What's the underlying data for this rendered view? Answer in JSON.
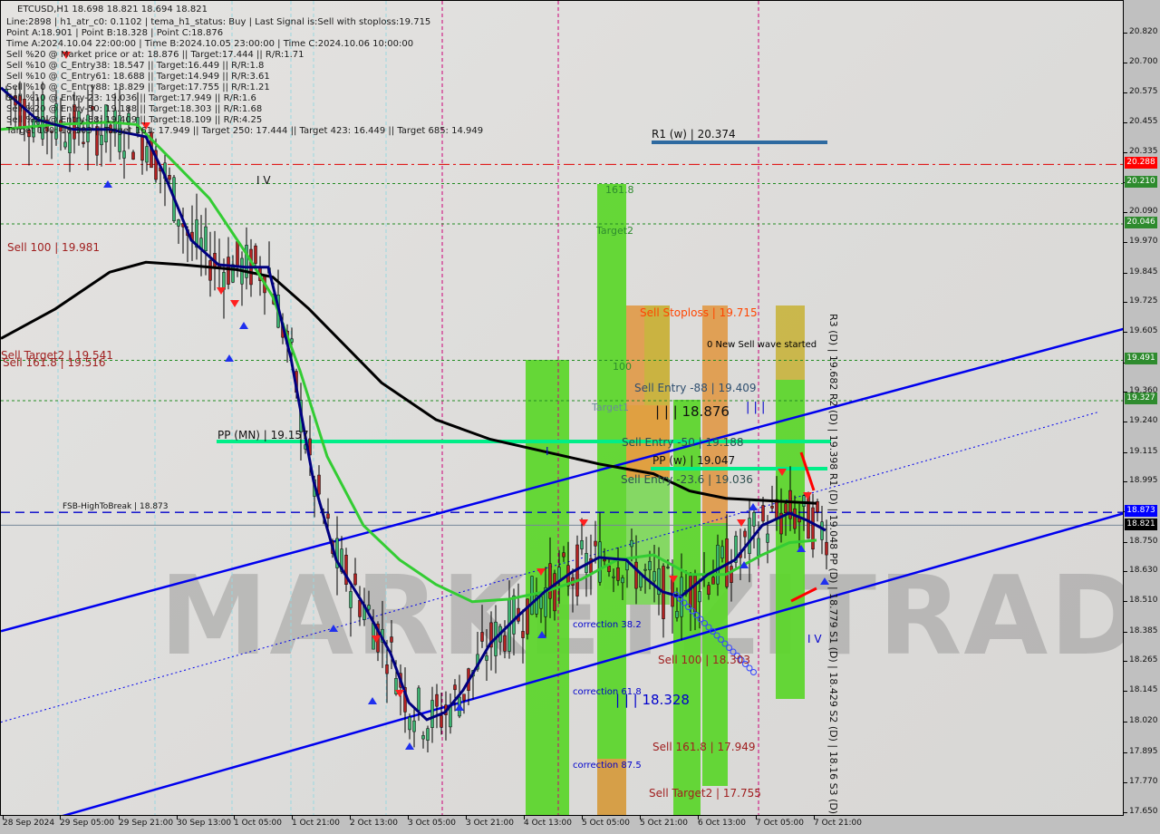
{
  "header": {
    "symbol_line": "ETCUSD,H1  18.698 18.821 18.694 18.821",
    "info_lines": [
      "Line:2898 | h1_atr_c0: 0.1102 | tema_h1_status: Buy | Last Signal is:Sell with stoploss:19.715",
      "Point A:18.901 | Point B:18.328 | Point C:18.876",
      "Time A:2024.10.04 22:00:00 | Time B:2024.10.05 23:00:00 | Time C:2024.10.06 10:00:00",
      "Sell %20 @ Market price or at: 18.876 || Target:17.444 || R/R:1.71",
      "Sell %10 @ C_Entry38: 18.547 || Target:16.449 || R/R:1.8",
      "Sell %10 @ C_Entry61: 18.688 || Target:14.949 || R/R:3.61",
      "Sell %10 @ C_Entry88: 18.829 || Target:17.755 || R/R:1.21",
      "Sell %10 @ Entry-23: 19.036 || Target:17.949 || R/R:1.6",
      "Sell %20 @ Entry-50: 19.188 || Target:18.303 || R/R:1.68",
      "Sell %20 @ Entry-88: 19.409 || Target:18.109 || R/R:4.25",
      "Target 100: 18.303 || Target 161: 17.949 || Target 250: 17.444 || Target 423: 16.449 || Target 685: 14.949"
    ]
  },
  "watermark": "MARKETZITRADE",
  "chart_data": {
    "type": "candlestick",
    "title": "ETCUSD,H1",
    "ohlc_last": {
      "open": 18.698,
      "high": 18.821,
      "low": 18.694,
      "close": 18.821
    },
    "ylim": [
      17.65,
      20.88
    ],
    "y_ticks": [
      20.82,
      20.7,
      20.575,
      20.455,
      20.335,
      20.21,
      20.09,
      19.97,
      19.845,
      19.725,
      19.605,
      19.48,
      19.36,
      19.24,
      19.115,
      18.995,
      18.873,
      18.75,
      18.63,
      18.51,
      18.385,
      18.265,
      18.145,
      18.02,
      17.895,
      17.77,
      17.65
    ],
    "y_tick_labels": [
      "20.820",
      "20.700",
      "20.575",
      "20.455",
      "20.335",
      "20.210",
      "20.090",
      "19.970",
      "19.845",
      "19.725",
      "19.605",
      "19.480",
      "19.360",
      "19.240",
      "19.115",
      "18.995",
      "18.873",
      "18.750",
      "18.630",
      "18.510",
      "18.385",
      "18.265",
      "18.145",
      "18.020",
      "17.895",
      "17.770",
      "17.650"
    ],
    "x_tick_labels": [
      "28 Sep 2024",
      "29 Sep 05:00",
      "29 Sep 21:00",
      "30 Sep 13:00",
      "1 Oct 05:00",
      "1 Oct 21:00",
      "2 Oct 13:00",
      "3 Oct 05:00",
      "3 Oct 21:00",
      "4 Oct 13:00",
      "5 Oct 05:00",
      "5 Oct 21:00",
      "6 Oct 13:00",
      "7 Oct 05:00",
      "7 Oct 21:00"
    ],
    "price_badges": [
      {
        "value": "20.288",
        "color": "#ff0000"
      },
      {
        "value": "20.210",
        "color": "#2e8b2e"
      },
      {
        "value": "20.046",
        "color": "#2e8b2e"
      },
      {
        "value": "19.491",
        "color": "#2e8b2e"
      },
      {
        "value": "19.327",
        "color": "#2e8b2e"
      },
      {
        "value": "18.873",
        "color": "#0000ff"
      },
      {
        "value": "18.821",
        "color": "#000000"
      }
    ],
    "horizontal_levels": [
      {
        "name": "stoploss-level",
        "value": 20.288,
        "color": "#e00000",
        "style": "dashdot"
      },
      {
        "name": "target-161-level",
        "value": 20.21,
        "color": "#228b22",
        "style": "dotted"
      },
      {
        "name": "target2-level",
        "value": 20.046,
        "color": "#228b22",
        "style": "dotted"
      },
      {
        "name": "target-100-level",
        "value": 19.491,
        "color": "#228b22",
        "style": "dotted"
      },
      {
        "name": "target1-level",
        "value": 19.327,
        "color": "#228b22",
        "style": "dotted"
      },
      {
        "name": "fsb-high-to-break",
        "value": 18.873,
        "color": "#0000cc",
        "style": "dashed"
      },
      {
        "name": "current-price",
        "value": 18.821,
        "color": "#778899",
        "style": "solid"
      }
    ],
    "annotations": [
      {
        "text": "R1 (w) | 20.374",
        "value": 20.374
      },
      {
        "text": "Sell 100 | 19.981",
        "value": 19.981
      },
      {
        "text": "Sell Target2 | 19.541",
        "value": 19.541
      },
      {
        "text": "Sell 161.8 | 19.516",
        "value": 19.516
      },
      {
        "text": "PP (MN) | 19.157",
        "value": 19.157
      },
      {
        "text": "FSB-HighToBreak | 18.873",
        "value": 18.873
      },
      {
        "text": "Sell Stoploss | 19.715",
        "value": 19.715
      },
      {
        "text": "0 New Sell wave started",
        "value": 19.6
      },
      {
        "text": "100",
        "value": 19.49
      },
      {
        "text": "Sell Entry -88 | 19.409",
        "value": 19.409
      },
      {
        "text": "Target1",
        "value": 19.327
      },
      {
        "text": "| | | 18.876",
        "value": 19.3
      },
      {
        "text": "| | |",
        "value": 19.33
      },
      {
        "text": "Sell Entry -50 | 19.188",
        "value": 19.188
      },
      {
        "text": "PP (w) | 19.047",
        "value": 19.047
      },
      {
        "text": "Sell Entry -23.6 | 19.036",
        "value": 19.036
      },
      {
        "text": "161.8",
        "value": 20.2
      },
      {
        "text": "Target2",
        "value": 20.03
      },
      {
        "text": "I V",
        "value": 20.21
      },
      {
        "text": "I V",
        "value": 18.4
      },
      {
        "text": "I",
        "value": 19.14
      },
      {
        "text": "correction 38.2",
        "value": 18.44
      },
      {
        "text": "correction 61.8",
        "value": 18.16
      },
      {
        "text": "| | | 18.328",
        "value": 18.12
      },
      {
        "text": "Sell 100 | 18.303",
        "value": 18.3
      },
      {
        "text": "Sell 161.8 | 17.949",
        "value": 17.949
      },
      {
        "text": "correction 87.5",
        "value": 17.86
      },
      {
        "text": "Sell Target2 | 17.755",
        "value": 17.755
      }
    ],
    "pivot_labels_vertical": "R3 (D) | 19.682 R2 (D) | 19.398 R1 (D) | 19.048 PP (D) | 18.779 S1 (D) | 18.429 S2 (D) | 18.16 S3 (D) |",
    "series": [
      {
        "name": "SMA long (black)",
        "color": "#000000",
        "points": [
          [
            0,
            19.58
          ],
          [
            60,
            19.7
          ],
          [
            120,
            19.85
          ],
          [
            160,
            19.89
          ],
          [
            200,
            19.88
          ],
          [
            260,
            19.86
          ],
          [
            300,
            19.83
          ],
          [
            340,
            19.7
          ],
          [
            380,
            19.55
          ],
          [
            420,
            19.4
          ],
          [
            480,
            19.25
          ],
          [
            540,
            19.17
          ],
          [
            600,
            19.12
          ],
          [
            660,
            19.07
          ],
          [
            720,
            19.03
          ],
          [
            760,
            18.96
          ],
          [
            800,
            18.93
          ],
          [
            850,
            18.92
          ],
          [
            900,
            18.91
          ]
        ]
      },
      {
        "name": "MA mid (green)",
        "color": "#33cc33",
        "points": [
          [
            0,
            20.43
          ],
          [
            60,
            20.45
          ],
          [
            120,
            20.46
          ],
          [
            150,
            20.45
          ],
          [
            190,
            20.3
          ],
          [
            230,
            20.15
          ],
          [
            270,
            19.93
          ],
          [
            300,
            19.75
          ],
          [
            330,
            19.45
          ],
          [
            360,
            19.1
          ],
          [
            400,
            18.82
          ],
          [
            440,
            18.68
          ],
          [
            480,
            18.58
          ],
          [
            520,
            18.51
          ],
          [
            560,
            18.52
          ],
          [
            600,
            18.55
          ],
          [
            640,
            18.6
          ],
          [
            680,
            18.68
          ],
          [
            720,
            18.7
          ],
          [
            760,
            18.62
          ],
          [
            800,
            18.62
          ],
          [
            840,
            18.7
          ],
          [
            870,
            18.75
          ],
          [
            900,
            18.76
          ]
        ]
      },
      {
        "name": "TEMA (navy)",
        "color": "#000080",
        "points": [
          [
            0,
            20.6
          ],
          [
            40,
            20.47
          ],
          [
            80,
            20.43
          ],
          [
            120,
            20.43
          ],
          [
            160,
            20.4
          ],
          [
            180,
            20.25
          ],
          [
            210,
            19.98
          ],
          [
            240,
            19.88
          ],
          [
            270,
            19.87
          ],
          [
            295,
            19.87
          ],
          [
            320,
            19.5
          ],
          [
            345,
            19.0
          ],
          [
            370,
            18.68
          ],
          [
            400,
            18.5
          ],
          [
            430,
            18.3
          ],
          [
            450,
            18.1
          ],
          [
            470,
            18.03
          ],
          [
            490,
            18.06
          ],
          [
            510,
            18.15
          ],
          [
            540,
            18.34
          ],
          [
            570,
            18.45
          ],
          [
            600,
            18.55
          ],
          [
            630,
            18.63
          ],
          [
            660,
            18.69
          ],
          [
            690,
            18.68
          ],
          [
            710,
            18.61
          ],
          [
            730,
            18.55
          ],
          [
            750,
            18.53
          ],
          [
            780,
            18.62
          ],
          [
            810,
            18.68
          ],
          [
            840,
            18.82
          ],
          [
            870,
            18.87
          ],
          [
            890,
            18.84
          ],
          [
            910,
            18.8
          ]
        ]
      }
    ],
    "channel_lines": [
      {
        "name": "channel-upper",
        "from": [
          0,
          18.39
        ],
        "to": [
          1240,
          19.62
        ]
      },
      {
        "name": "channel-lower",
        "from": [
          60,
          17.63
        ],
        "to": [
          1240,
          18.87
        ]
      },
      {
        "name": "channel-mid-dotted",
        "from": [
          0,
          18.02
        ],
        "to": [
          1210,
          19.28
        ]
      }
    ]
  }
}
